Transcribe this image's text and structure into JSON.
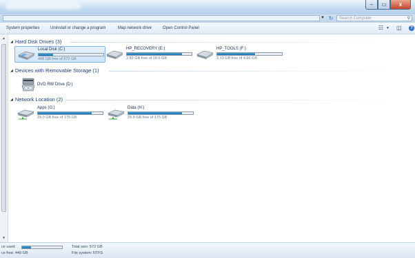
{
  "window": {
    "minimize_glyph": "–",
    "maximize_glyph": "▭",
    "close_glyph": "x"
  },
  "address": {
    "search_placeholder": "Search Computer"
  },
  "toolbar": {
    "items": [
      "System properties",
      "Uninstall or change a program",
      "Map network drive",
      "Open Control Panel"
    ]
  },
  "groups": {
    "hdd": {
      "title": "Hard Disk Drives (3)"
    },
    "removable": {
      "title": "Devices with Removable Storage (1)"
    },
    "network": {
      "title": "Network Location (2)"
    }
  },
  "drives": {
    "local": {
      "name": "Local Disk (C:)",
      "free": "448 GB free of 572 GB",
      "used_fraction": 0.22
    },
    "recovery": {
      "name": "HP_RECOVERY (E:)",
      "free": "2.83 GB free of 18.6 GB",
      "used_fraction": 0.85
    },
    "tools": {
      "name": "HP_TOOLS (F:)",
      "free": "2.10 GB free of 4.96 GB",
      "used_fraction": 0.58
    },
    "dvd": {
      "name": "DVD RW Drive (D:)"
    },
    "apps": {
      "name": "Apps (G:)",
      "free": "29.0 GB free of 175 GB",
      "used_fraction": 0.83
    },
    "data": {
      "name": "Data (H:)",
      "free": "29.8 GB free of 175 GB",
      "used_fraction": 0.83
    }
  },
  "status": {
    "space_used_label": "ce used:",
    "space_free_label": "ce free: 448 GB",
    "total_size": "Total size: 572 GB",
    "file_system": "File system: NTFS",
    "used_fraction": 0.22
  },
  "colors": {
    "bar_fill": "#1b6fad",
    "group_header": "#1e3f7a"
  },
  "icons": {
    "hdd": "hard-drive-icon",
    "network": "network-drive-icon",
    "dvd": "dvd-drive-icon"
  }
}
